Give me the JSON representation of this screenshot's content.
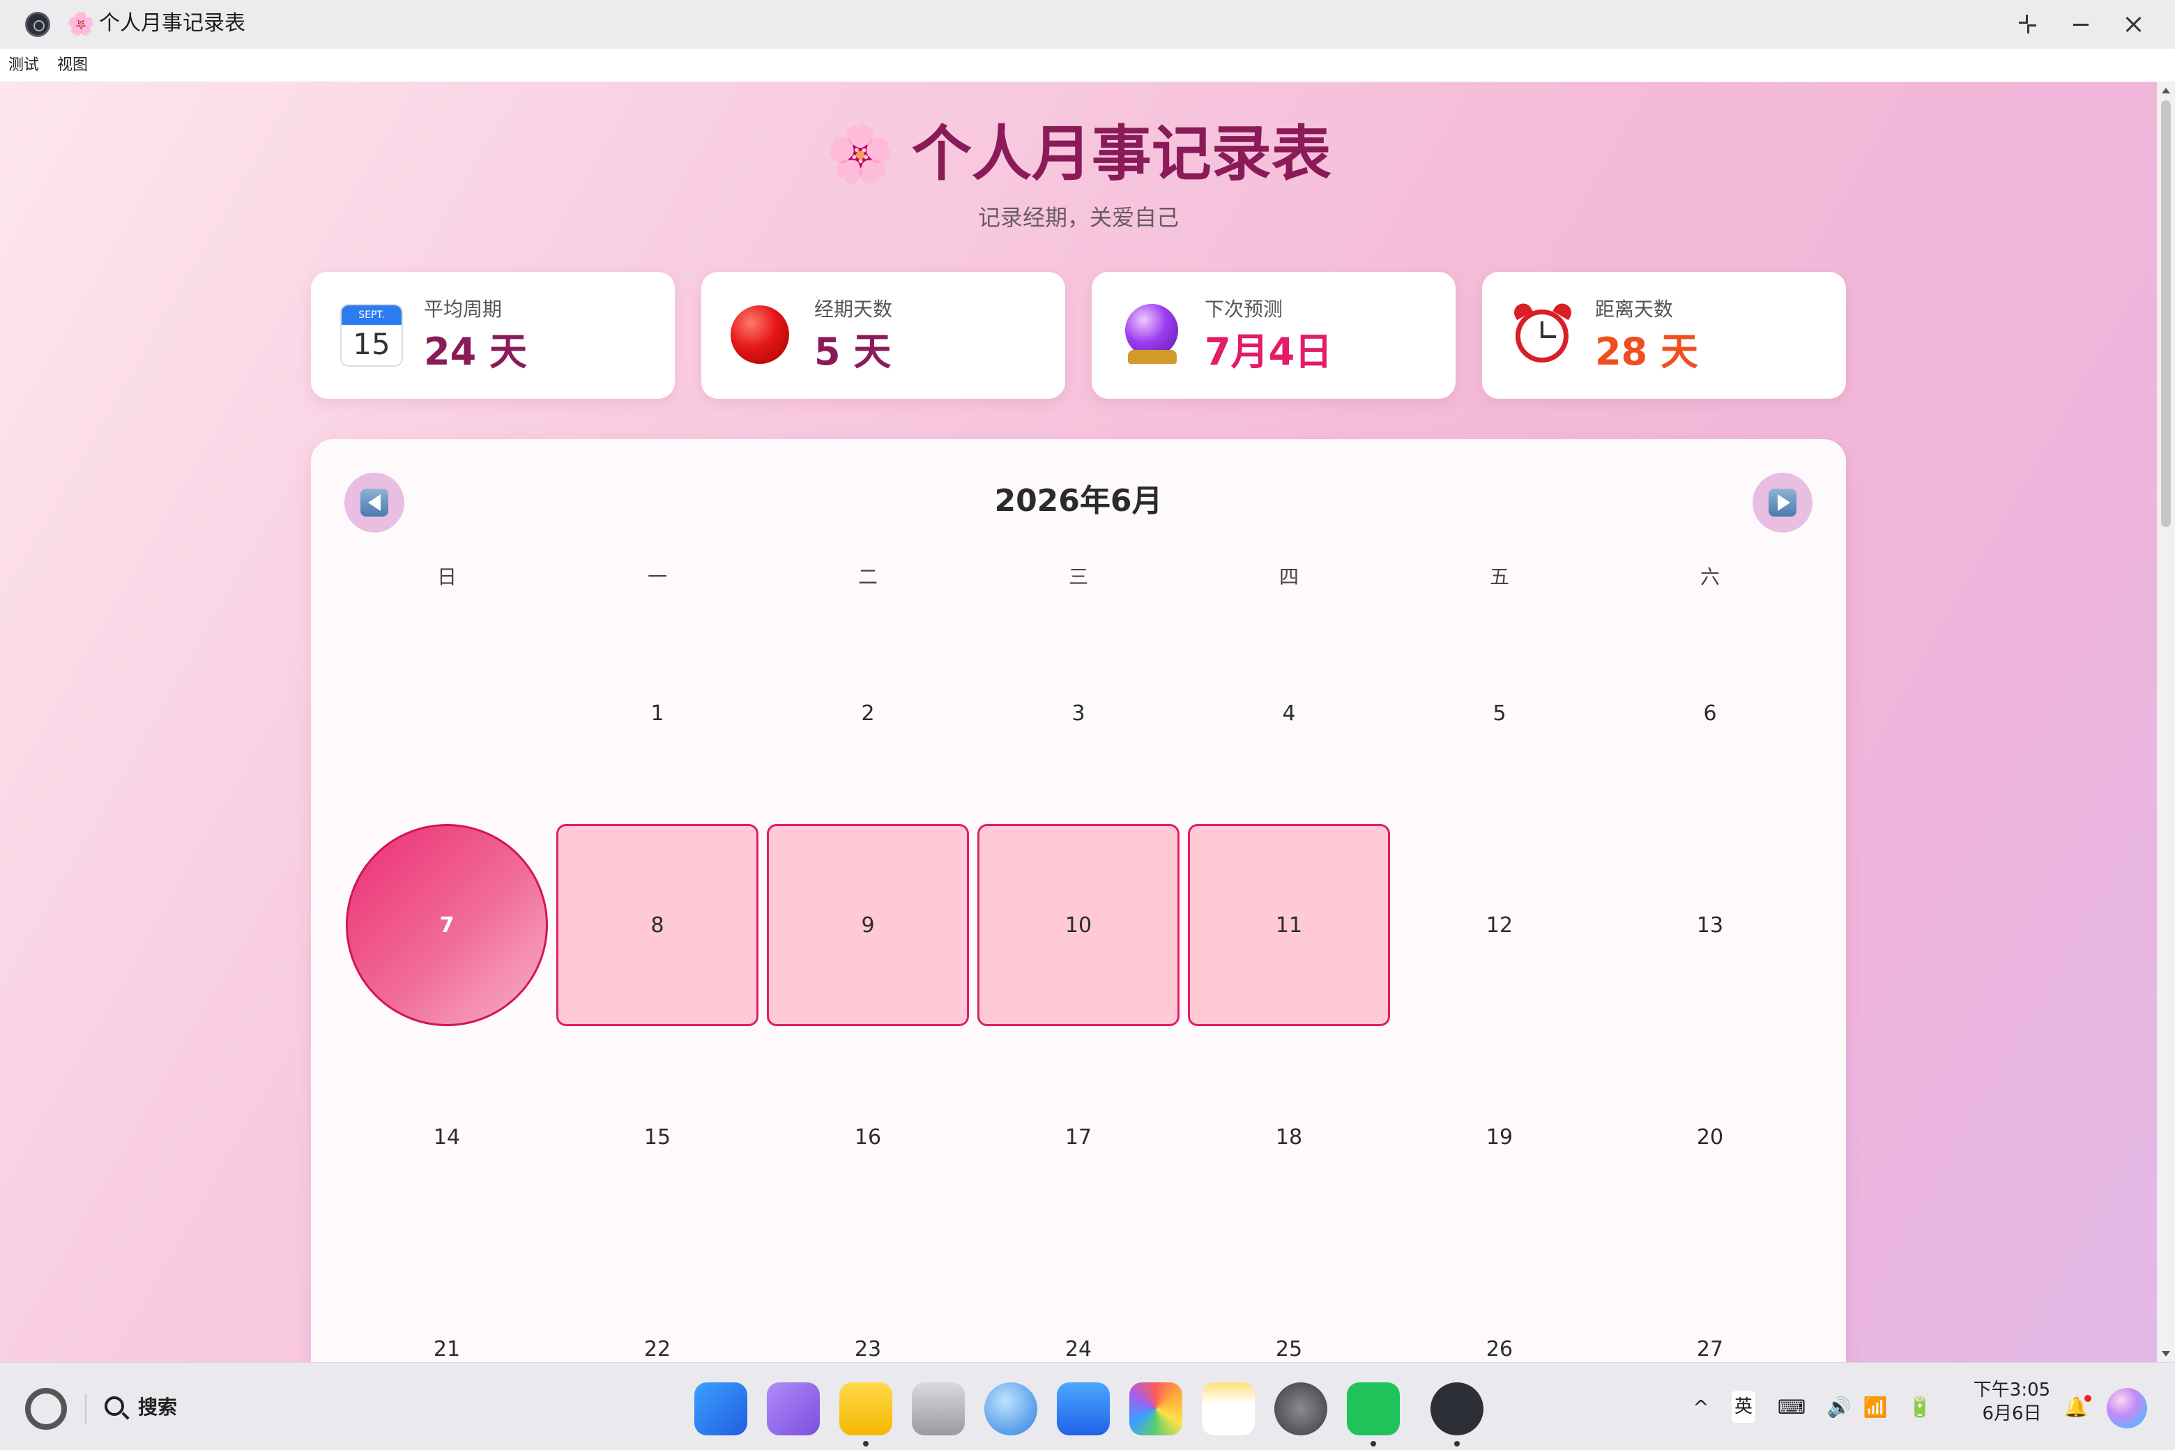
{
  "window": {
    "title_icon": "🌸",
    "title": "个人月事记录表",
    "controls": [
      "restore-icon",
      "minimize-icon",
      "close-icon"
    ]
  },
  "menu": {
    "items": [
      "测试",
      "视图"
    ]
  },
  "header": {
    "logo": "🌸",
    "title": "个人月事记录表",
    "subtitle": "记录经期，关爱自己"
  },
  "stats": [
    {
      "icon": "calendar-icon",
      "icon_month": "SEPT.",
      "icon_day": "15",
      "label": "平均周期",
      "value": "24 天",
      "color": "#8a1b58"
    },
    {
      "icon": "red-circle-icon",
      "label": "经期天数",
      "value": "5 天",
      "color": "#8a1b58"
    },
    {
      "icon": "crystal-ball-icon",
      "label": "下次预测",
      "value": "7月4日",
      "color": "#e31b68"
    },
    {
      "icon": "alarm-clock-icon",
      "label": "距离天数",
      "value": "28 天",
      "color": "#f04e1f"
    }
  ],
  "calendar": {
    "month_title": "2026年6月",
    "prev_icon": "previous-month-icon",
    "next_icon": "next-month-icon",
    "weekdays": [
      "日",
      "一",
      "二",
      "三",
      "四",
      "五",
      "六"
    ],
    "weeks": [
      [
        "",
        "1",
        "2",
        "3",
        "4",
        "5",
        "6"
      ],
      [
        "7",
        "8",
        "9",
        "10",
        "11",
        "12",
        "13"
      ],
      [
        "14",
        "15",
        "16",
        "17",
        "18",
        "19",
        "20"
      ],
      [
        "21",
        "22",
        "23",
        "24",
        "25",
        "26",
        "27"
      ]
    ],
    "period_start": "7",
    "period_days": [
      "8",
      "9",
      "10",
      "11"
    ],
    "colors": {
      "period_fill": "#ffcad6",
      "period_border": "#e01f64",
      "start_fill": "#ec2e74"
    }
  },
  "taskbar": {
    "search_label": "搜索",
    "apps": [
      "app-grid-icon",
      "multitask-icon",
      "folder-icon",
      "trash-icon",
      "browser-icon",
      "mail-icon",
      "gallery-icon",
      "notes-icon",
      "settings-icon",
      "wechat-icon",
      "electron-app-icon"
    ],
    "tray": {
      "input_method": "英",
      "time": "下午3:05",
      "date": "6月6日"
    }
  }
}
